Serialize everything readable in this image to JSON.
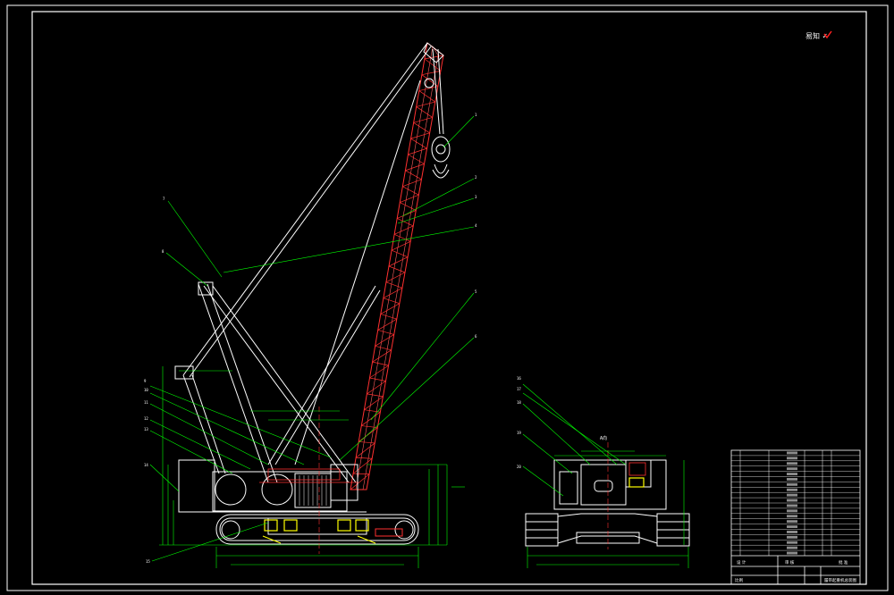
{
  "drawing": {
    "background": "#000000",
    "colors": {
      "frame": "#ffffff",
      "boom_lattice": "#ff3030",
      "leader_lines": "#00ff00",
      "dimensions": "#00ff00",
      "hatching": "#ffff00",
      "outline": "#ffffff",
      "centerline": "#ff0000",
      "red_stamp": "#ff2020"
    },
    "stamp": {
      "text": "易知 ✓",
      "icon": "stamp-icon"
    },
    "side_view_callouts": [
      "1",
      "2",
      "3",
      "4",
      "5",
      "6",
      "7",
      "8",
      "9",
      "10",
      "11",
      "12",
      "13",
      "14",
      "15"
    ],
    "front_view_callouts": [
      "16",
      "17",
      "18",
      "19",
      "20"
    ],
    "front_view_title": "A向",
    "title_block": {
      "rows": [
        "",
        "",
        "",
        "",
        "",
        "",
        "",
        "",
        "",
        "",
        "",
        "",
        "",
        "",
        "",
        "",
        "",
        "",
        "",
        ""
      ],
      "designer_label": "设 计",
      "checker_label": "审 核",
      "approve_label": "批 准",
      "scale_label": "比例",
      "drawing_name": "履带起重机总装图"
    }
  }
}
